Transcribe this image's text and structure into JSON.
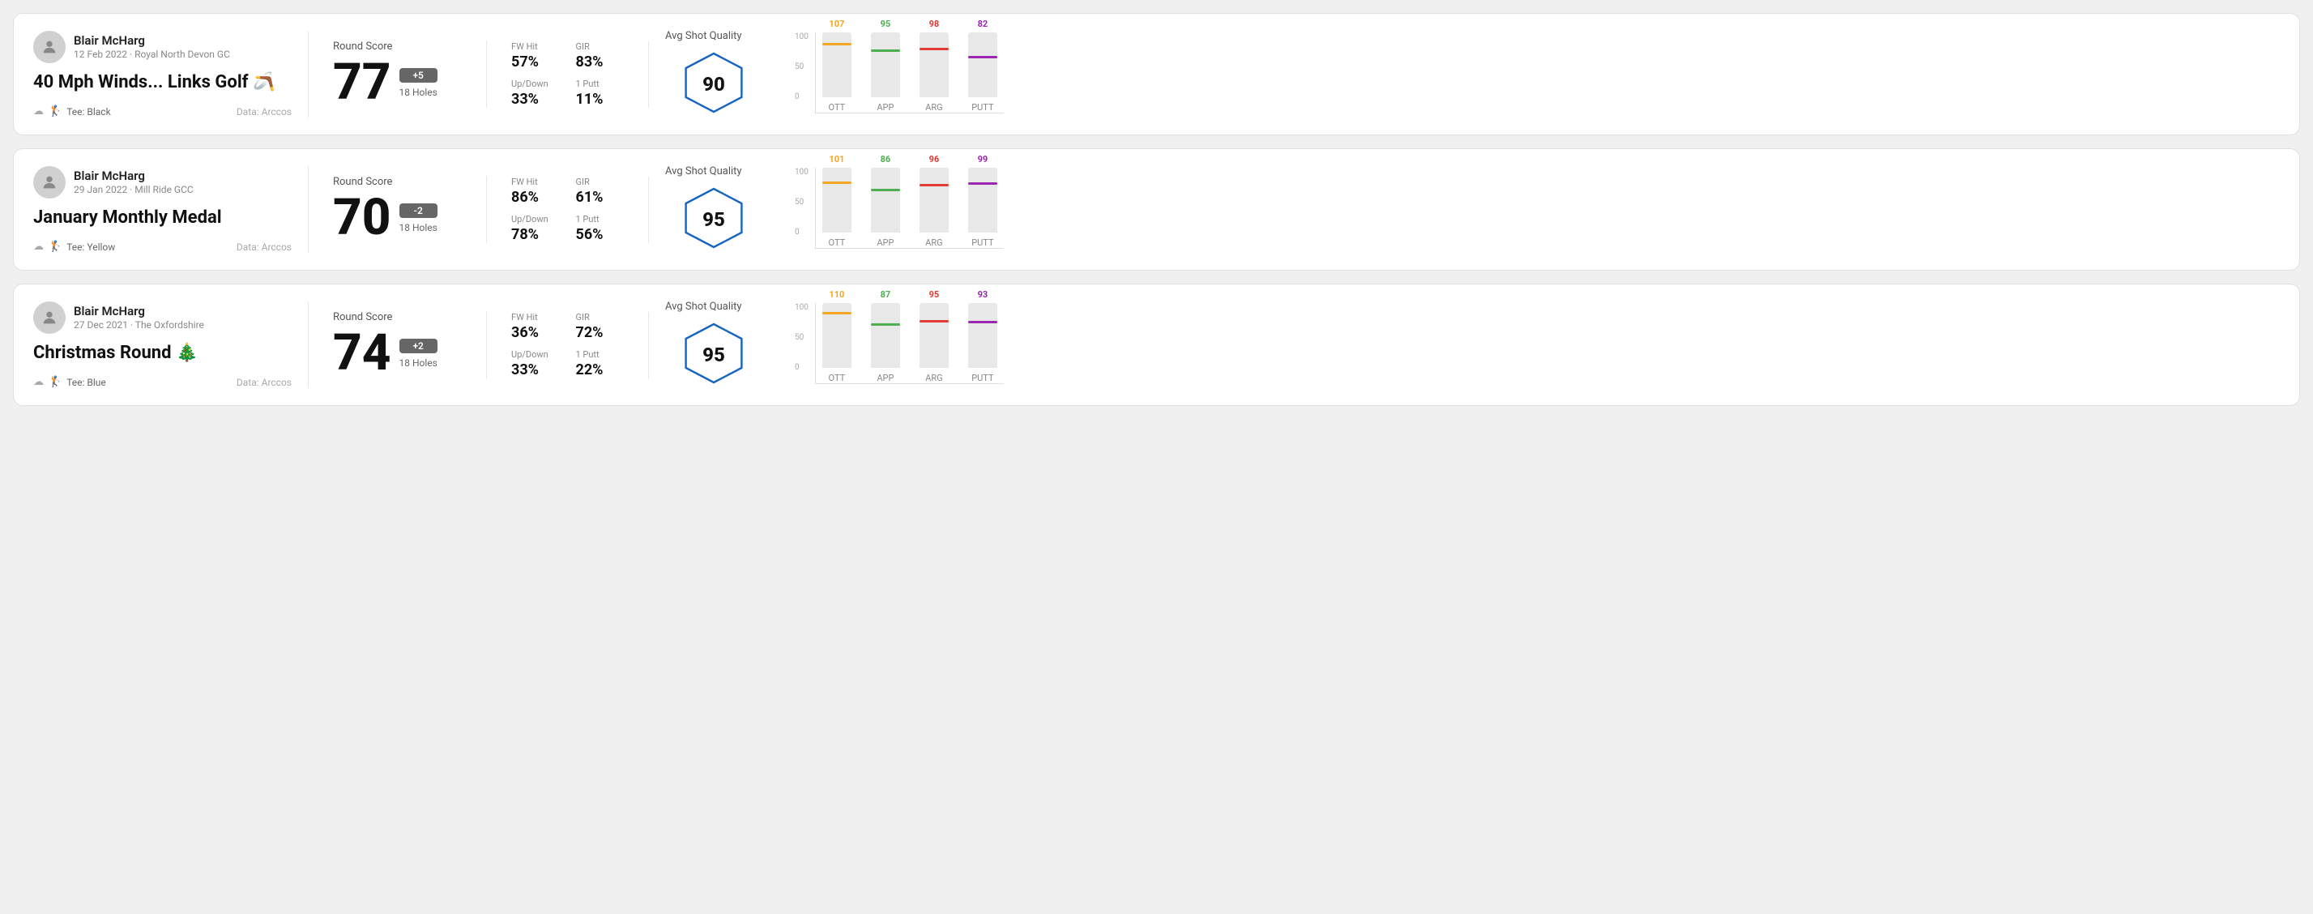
{
  "rounds": [
    {
      "id": "round1",
      "user_name": "Blair McHarg",
      "user_date": "12 Feb 2022 · Royal North Devon GC",
      "title": "40 Mph Winds... Links Golf 🪃",
      "tee": "Black",
      "data_source": "Data: Arccos",
      "score": "77",
      "score_diff": "+5",
      "holes": "18 Holes",
      "fw_hit": "57%",
      "gir": "83%",
      "up_down": "33%",
      "one_putt": "11%",
      "avg_shot_quality": "90",
      "chart": {
        "bars": [
          {
            "label": "OTT",
            "value": 107,
            "color": "#f5a623",
            "max": 130
          },
          {
            "label": "APP",
            "value": 95,
            "color": "#4CAF50",
            "max": 130
          },
          {
            "label": "ARG",
            "value": 98,
            "color": "#e53935",
            "max": 130
          },
          {
            "label": "PUTT",
            "value": 82,
            "color": "#9c27b0",
            "max": 130
          }
        ]
      }
    },
    {
      "id": "round2",
      "user_name": "Blair McHarg",
      "user_date": "29 Jan 2022 · Mill Ride GCC",
      "title": "January Monthly Medal",
      "tee": "Yellow",
      "data_source": "Data: Arccos",
      "score": "70",
      "score_diff": "-2",
      "holes": "18 Holes",
      "fw_hit": "86%",
      "gir": "61%",
      "up_down": "78%",
      "one_putt": "56%",
      "avg_shot_quality": "95",
      "chart": {
        "bars": [
          {
            "label": "OTT",
            "value": 101,
            "color": "#f5a623",
            "max": 130
          },
          {
            "label": "APP",
            "value": 86,
            "color": "#4CAF50",
            "max": 130
          },
          {
            "label": "ARG",
            "value": 96,
            "color": "#e53935",
            "max": 130
          },
          {
            "label": "PUTT",
            "value": 99,
            "color": "#9c27b0",
            "max": 130
          }
        ]
      }
    },
    {
      "id": "round3",
      "user_name": "Blair McHarg",
      "user_date": "27 Dec 2021 · The Oxfordshire",
      "title": "Christmas Round 🎄",
      "tee": "Blue",
      "data_source": "Data: Arccos",
      "score": "74",
      "score_diff": "+2",
      "holes": "18 Holes",
      "fw_hit": "36%",
      "gir": "72%",
      "up_down": "33%",
      "one_putt": "22%",
      "avg_shot_quality": "95",
      "chart": {
        "bars": [
          {
            "label": "OTT",
            "value": 110,
            "color": "#f5a623",
            "max": 130
          },
          {
            "label": "APP",
            "value": 87,
            "color": "#4CAF50",
            "max": 130
          },
          {
            "label": "ARG",
            "value": 95,
            "color": "#e53935",
            "max": 130
          },
          {
            "label": "PUTT",
            "value": 93,
            "color": "#9c27b0",
            "max": 130
          }
        ]
      }
    }
  ],
  "labels": {
    "round_score": "Round Score",
    "fw_hit": "FW Hit",
    "gir": "GIR",
    "up_down": "Up/Down",
    "one_putt": "1 Putt",
    "avg_shot_quality": "Avg Shot Quality",
    "y_axis_100": "100",
    "y_axis_50": "50",
    "y_axis_0": "0"
  }
}
